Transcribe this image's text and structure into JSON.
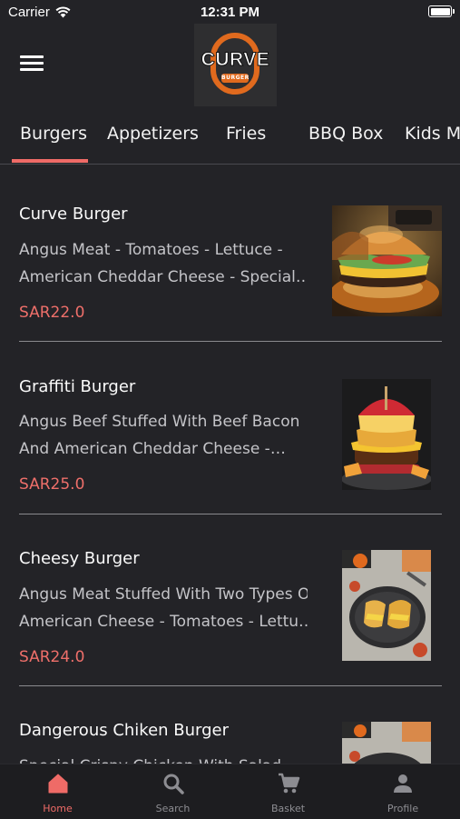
{
  "status_bar": {
    "carrier": "Carrier",
    "time": "12:31 PM",
    "battery_level": 1.0
  },
  "header": {
    "menu_icon": "hamburger-menu-icon",
    "logo_text": "CURVE",
    "logo_subtext": "BURGER"
  },
  "categories": [
    {
      "label": "Burgers",
      "selected": true
    },
    {
      "label": "Appetizers",
      "selected": false
    },
    {
      "label": "Fries",
      "selected": false
    },
    {
      "label": "BBQ Box",
      "selected": false
    },
    {
      "label": "Kids Me",
      "selected": false
    }
  ],
  "menu_items": [
    {
      "title": "Curve Burger",
      "desc_line1": "Angus Meat - Tomatoes - Lettuce -",
      "desc_line2": "American Cheddar Cheese - Special…",
      "price": "SAR22.0"
    },
    {
      "title": "Graffiti Burger",
      "desc_line1": "Angus Beef Stuffed With Beef Bacon",
      "desc_line2": "And American Cheddar Cheese -…",
      "price": "SAR25.0"
    },
    {
      "title": "Cheesy Burger",
      "desc_line1": "Angus Meat Stuffed With Two Types Of",
      "desc_line2": "American Cheese - Tomatoes - Lettu…",
      "price": "SAR24.0"
    },
    {
      "title": "Dangerous Chiken Burger",
      "desc_line1": "Special Crispy Chicken With Salad",
      "desc_line2": "",
      "price": ""
    }
  ],
  "tab_bar": [
    {
      "label": "Home",
      "icon": "home-icon",
      "active": true
    },
    {
      "label": "Search",
      "icon": "search-icon",
      "active": false
    },
    {
      "label": "Basket",
      "icon": "cart-icon",
      "active": false
    },
    {
      "label": "Profile",
      "icon": "person-icon",
      "active": false
    }
  ],
  "colors": {
    "accent": "#ef6b67",
    "background": "#232327",
    "logo_orange": "#e06a1e"
  }
}
